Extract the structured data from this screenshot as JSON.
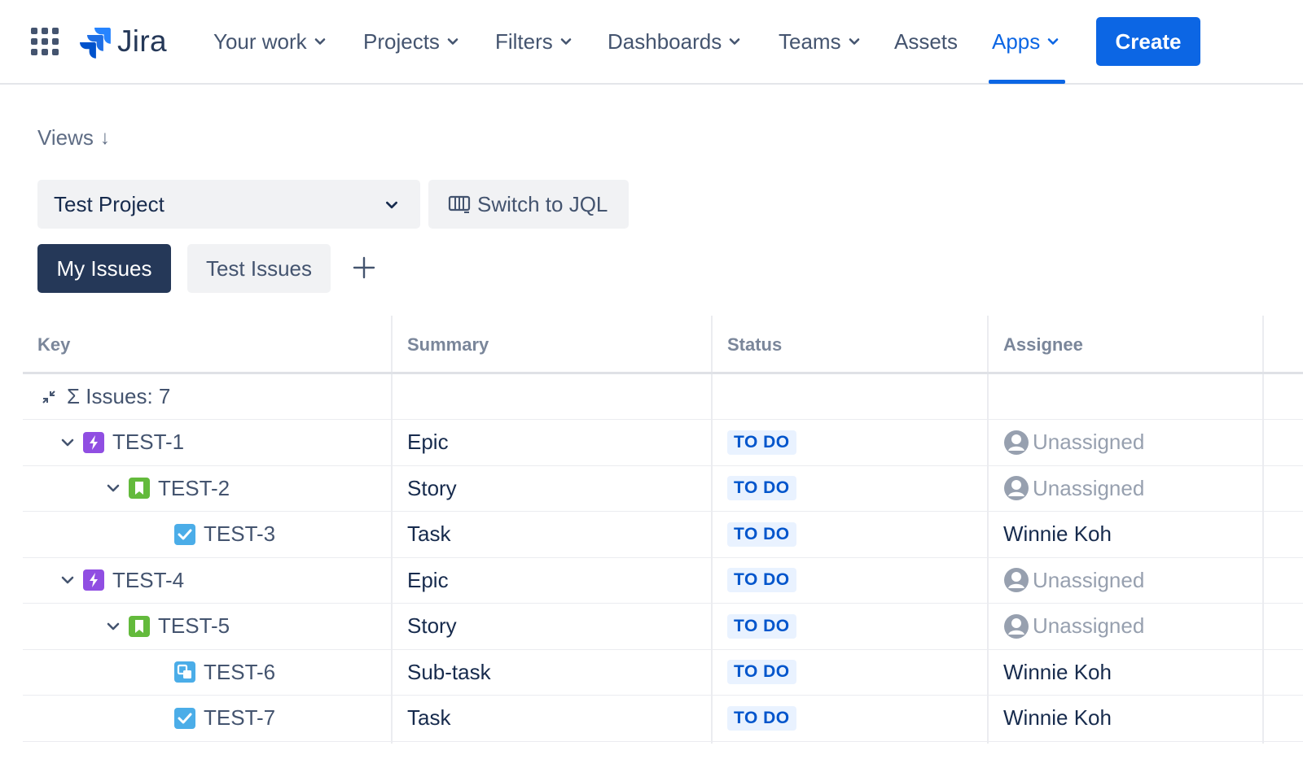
{
  "nav": {
    "logo_text": "Jira",
    "items": [
      {
        "label": "Your work",
        "has_dropdown": true
      },
      {
        "label": "Projects",
        "has_dropdown": true
      },
      {
        "label": "Filters",
        "has_dropdown": true
      },
      {
        "label": "Dashboards",
        "has_dropdown": true
      },
      {
        "label": "Teams",
        "has_dropdown": true
      },
      {
        "label": "Assets",
        "has_dropdown": false
      },
      {
        "label": "Apps",
        "has_dropdown": true,
        "active": true
      }
    ],
    "create_label": "Create"
  },
  "views": {
    "label": "Views",
    "arrow": "↓",
    "project_select": "Test Project",
    "jql_button": "Switch to JQL",
    "tabs": [
      "My Issues",
      "Test Issues"
    ],
    "active_tab": "My Issues"
  },
  "table": {
    "columns": [
      "Key",
      "Summary",
      "Status",
      "Assignee"
    ],
    "summary_row": "Σ Issues: 7",
    "rows": [
      {
        "key": "TEST-1",
        "summary": "Epic",
        "status": "TO DO",
        "assignee": "Unassigned",
        "type": "epic-icon",
        "level": 0,
        "expandable": true
      },
      {
        "key": "TEST-2",
        "summary": "Story",
        "status": "TO DO",
        "assignee": "Unassigned",
        "type": "story-icon",
        "level": 1,
        "expandable": true
      },
      {
        "key": "TEST-3",
        "summary": "Task",
        "status": "TO DO",
        "assignee": "Winnie Koh",
        "type": "task-icon",
        "level": 2,
        "expandable": false
      },
      {
        "key": "TEST-4",
        "summary": "Epic",
        "status": "TO DO",
        "assignee": "Unassigned",
        "type": "epic-icon",
        "level": 0,
        "expandable": true
      },
      {
        "key": "TEST-5",
        "summary": "Story",
        "status": "TO DO",
        "assignee": "Unassigned",
        "type": "story-icon",
        "level": 1,
        "expandable": true
      },
      {
        "key": "TEST-6",
        "summary": "Sub-task",
        "status": "TO DO",
        "assignee": "Winnie Koh",
        "type": "subtask-icon",
        "level": 2,
        "expandable": false
      },
      {
        "key": "TEST-7",
        "summary": "Task",
        "status": "TO DO",
        "assignee": "Winnie Koh",
        "type": "task-icon",
        "level": 2,
        "expandable": false
      }
    ]
  },
  "colors": {
    "brand_blue": "#0c66e4",
    "tab_active_bg": "#253858",
    "epic": "#904ee2",
    "story": "#63ba3c",
    "task": "#4bade8",
    "lozenge_bg": "#e9f2ff",
    "lozenge_text": "#0055cc"
  }
}
